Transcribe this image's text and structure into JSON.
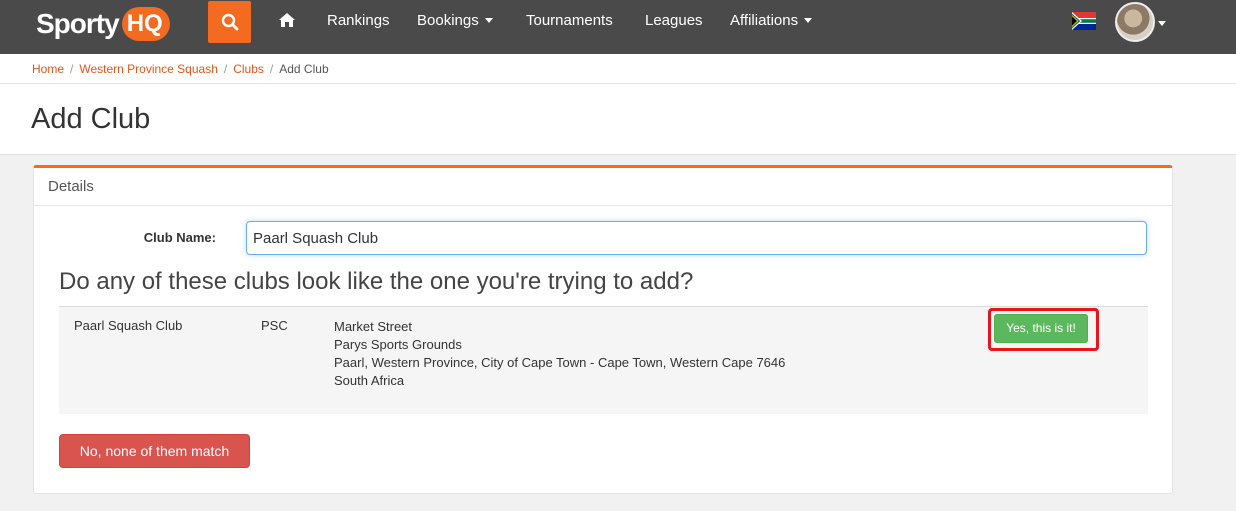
{
  "brand": {
    "logo_text": "Sporty",
    "logo_badge": "HQ",
    "accent_color": "#f26b21"
  },
  "nav": {
    "search_icon": "search-icon",
    "home_icon": "home-icon",
    "items": [
      {
        "label": "Rankings",
        "dropdown": false
      },
      {
        "label": "Bookings",
        "dropdown": true
      },
      {
        "label": "Tournaments",
        "dropdown": false
      },
      {
        "label": "Leagues",
        "dropdown": false
      },
      {
        "label": "Affiliations",
        "dropdown": true
      }
    ],
    "flag_icon": "south-africa-flag-icon"
  },
  "breadcrumb": {
    "items": [
      "Home",
      "Western Province Squash",
      "Clubs"
    ],
    "current": "Add Club"
  },
  "page": {
    "title": "Add Club"
  },
  "panel": {
    "heading": "Details",
    "club_name_label": "Club Name:",
    "club_name_value": "Paarl Squash Club",
    "question": "Do any of these clubs look like the one you're trying to add?",
    "matches": [
      {
        "name": "Paarl Squash Club",
        "code": "PSC",
        "address": [
          "Market Street",
          "Parys Sports Grounds",
          "Paarl, Western Province, City of Cape Town - Cape Town, Western Cape 7646",
          "South Africa"
        ],
        "confirm_label": "Yes, this is it!"
      }
    ],
    "no_match_label": "No, none of them match"
  }
}
